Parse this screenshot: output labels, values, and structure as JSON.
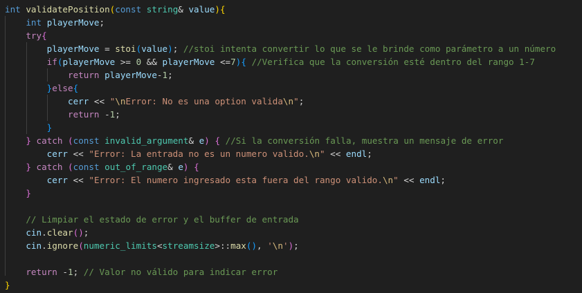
{
  "code": {
    "lines": [
      [
        [
          "kw",
          "int"
        ],
        [
          "pn",
          " "
        ],
        [
          "fn",
          "validatePosition"
        ],
        [
          "b1",
          "("
        ],
        [
          "kw",
          "const"
        ],
        [
          "pn",
          " "
        ],
        [
          "ty",
          "string"
        ],
        [
          "pn",
          "& "
        ],
        [
          "var",
          "value"
        ],
        [
          "b1",
          ")"
        ],
        [
          "b1",
          "{"
        ]
      ],
      [
        [
          "pn",
          "    "
        ],
        [
          "kw",
          "int"
        ],
        [
          "pn",
          " "
        ],
        [
          "var",
          "playerMove"
        ],
        [
          "pn",
          ";"
        ]
      ],
      [
        [
          "pn",
          "    "
        ],
        [
          "ctl",
          "try"
        ],
        [
          "b2",
          "{"
        ]
      ],
      [
        [
          "pn",
          "        "
        ],
        [
          "var",
          "playerMove"
        ],
        [
          "pn",
          " = "
        ],
        [
          "fn",
          "stoi"
        ],
        [
          "b3",
          "("
        ],
        [
          "var",
          "value"
        ],
        [
          "b3",
          ")"
        ],
        [
          "pn",
          "; "
        ],
        [
          "com",
          "//stoi intenta convertir lo que se le brinde como parámetro a un número"
        ]
      ],
      [
        [
          "pn",
          "        "
        ],
        [
          "ctl",
          "if"
        ],
        [
          "b3",
          "("
        ],
        [
          "var",
          "playerMove"
        ],
        [
          "pn",
          " >= "
        ],
        [
          "num",
          "0"
        ],
        [
          "pn",
          " && "
        ],
        [
          "var",
          "playerMove"
        ],
        [
          "pn",
          " <="
        ],
        [
          "num",
          "7"
        ],
        [
          "b3",
          ")"
        ],
        [
          "b3",
          "{"
        ],
        [
          "pn",
          " "
        ],
        [
          "com",
          "//Verifica que la conversión esté dentro del rango 1-7"
        ]
      ],
      [
        [
          "pn",
          "            "
        ],
        [
          "ctl",
          "return"
        ],
        [
          "pn",
          " "
        ],
        [
          "var",
          "playerMove"
        ],
        [
          "pn",
          "-"
        ],
        [
          "num",
          "1"
        ],
        [
          "pn",
          ";"
        ]
      ],
      [
        [
          "pn",
          "        "
        ],
        [
          "b3",
          "}"
        ],
        [
          "ctl",
          "else"
        ],
        [
          "b3",
          "{"
        ]
      ],
      [
        [
          "pn",
          "            "
        ],
        [
          "var",
          "cerr"
        ],
        [
          "pn",
          " << "
        ],
        [
          "str",
          "\""
        ],
        [
          "esc",
          "\\n"
        ],
        [
          "str",
          "Error: No es una option valida"
        ],
        [
          "esc",
          "\\n"
        ],
        [
          "str",
          "\""
        ],
        [
          "pn",
          ";"
        ]
      ],
      [
        [
          "pn",
          "            "
        ],
        [
          "ctl",
          "return"
        ],
        [
          "pn",
          " -"
        ],
        [
          "num",
          "1"
        ],
        [
          "pn",
          ";"
        ]
      ],
      [
        [
          "pn",
          "        "
        ],
        [
          "b3",
          "}"
        ]
      ],
      [
        [
          "pn",
          "    "
        ],
        [
          "b2",
          "}"
        ],
        [
          "pn",
          " "
        ],
        [
          "ctl",
          "catch"
        ],
        [
          "pn",
          " "
        ],
        [
          "b2",
          "("
        ],
        [
          "kw",
          "const"
        ],
        [
          "pn",
          " "
        ],
        [
          "ty",
          "invalid_argument"
        ],
        [
          "pn",
          "& "
        ],
        [
          "var",
          "e"
        ],
        [
          "b2",
          ")"
        ],
        [
          "pn",
          " "
        ],
        [
          "b2",
          "{"
        ],
        [
          "pn",
          " "
        ],
        [
          "com",
          "//Si la conversión falla, muestra un mensaje de error"
        ]
      ],
      [
        [
          "pn",
          "        "
        ],
        [
          "var",
          "cerr"
        ],
        [
          "pn",
          " << "
        ],
        [
          "str",
          "\"Error: La entrada no es un numero valido."
        ],
        [
          "esc",
          "\\n"
        ],
        [
          "str",
          "\""
        ],
        [
          "pn",
          " << "
        ],
        [
          "var",
          "endl"
        ],
        [
          "pn",
          ";"
        ]
      ],
      [
        [
          "pn",
          "    "
        ],
        [
          "b2",
          "}"
        ],
        [
          "pn",
          " "
        ],
        [
          "ctl",
          "catch"
        ],
        [
          "pn",
          " "
        ],
        [
          "b2",
          "("
        ],
        [
          "kw",
          "const"
        ],
        [
          "pn",
          " "
        ],
        [
          "ty",
          "out_of_range"
        ],
        [
          "pn",
          "& "
        ],
        [
          "var",
          "e"
        ],
        [
          "b2",
          ")"
        ],
        [
          "pn",
          " "
        ],
        [
          "b2",
          "{"
        ]
      ],
      [
        [
          "pn",
          "        "
        ],
        [
          "var",
          "cerr"
        ],
        [
          "pn",
          " << "
        ],
        [
          "str",
          "\"Error: El numero ingresado esta fuera del rango valido."
        ],
        [
          "esc",
          "\\n"
        ],
        [
          "str",
          "\""
        ],
        [
          "pn",
          " << "
        ],
        [
          "var",
          "endl"
        ],
        [
          "pn",
          ";"
        ]
      ],
      [
        [
          "pn",
          "    "
        ],
        [
          "b2",
          "}"
        ]
      ],
      [],
      [
        [
          "pn",
          "    "
        ],
        [
          "com",
          "// Limpiar el estado de error y el buffer de entrada"
        ]
      ],
      [
        [
          "pn",
          "    "
        ],
        [
          "var",
          "cin"
        ],
        [
          "pn",
          "."
        ],
        [
          "fn",
          "clear"
        ],
        [
          "b2",
          "()"
        ],
        [
          "pn",
          ";"
        ]
      ],
      [
        [
          "pn",
          "    "
        ],
        [
          "var",
          "cin"
        ],
        [
          "pn",
          "."
        ],
        [
          "fn",
          "ignore"
        ],
        [
          "b2",
          "("
        ],
        [
          "ty",
          "numeric_limits"
        ],
        [
          "pn",
          "<"
        ],
        [
          "ty",
          "streamsize"
        ],
        [
          "pn",
          ">::"
        ],
        [
          "fn",
          "max"
        ],
        [
          "b3",
          "()"
        ],
        [
          "pn",
          ", "
        ],
        [
          "str",
          "'"
        ],
        [
          "esc",
          "\\n"
        ],
        [
          "str",
          "'"
        ],
        [
          "b2",
          ")"
        ],
        [
          "pn",
          ";"
        ]
      ],
      [],
      [
        [
          "pn",
          "    "
        ],
        [
          "ctl",
          "return"
        ],
        [
          "pn",
          " -"
        ],
        [
          "num",
          "1"
        ],
        [
          "pn",
          "; "
        ],
        [
          "com",
          "// Valor no válido para indicar error"
        ]
      ],
      [
        [
          "b1",
          "}"
        ]
      ]
    ]
  }
}
